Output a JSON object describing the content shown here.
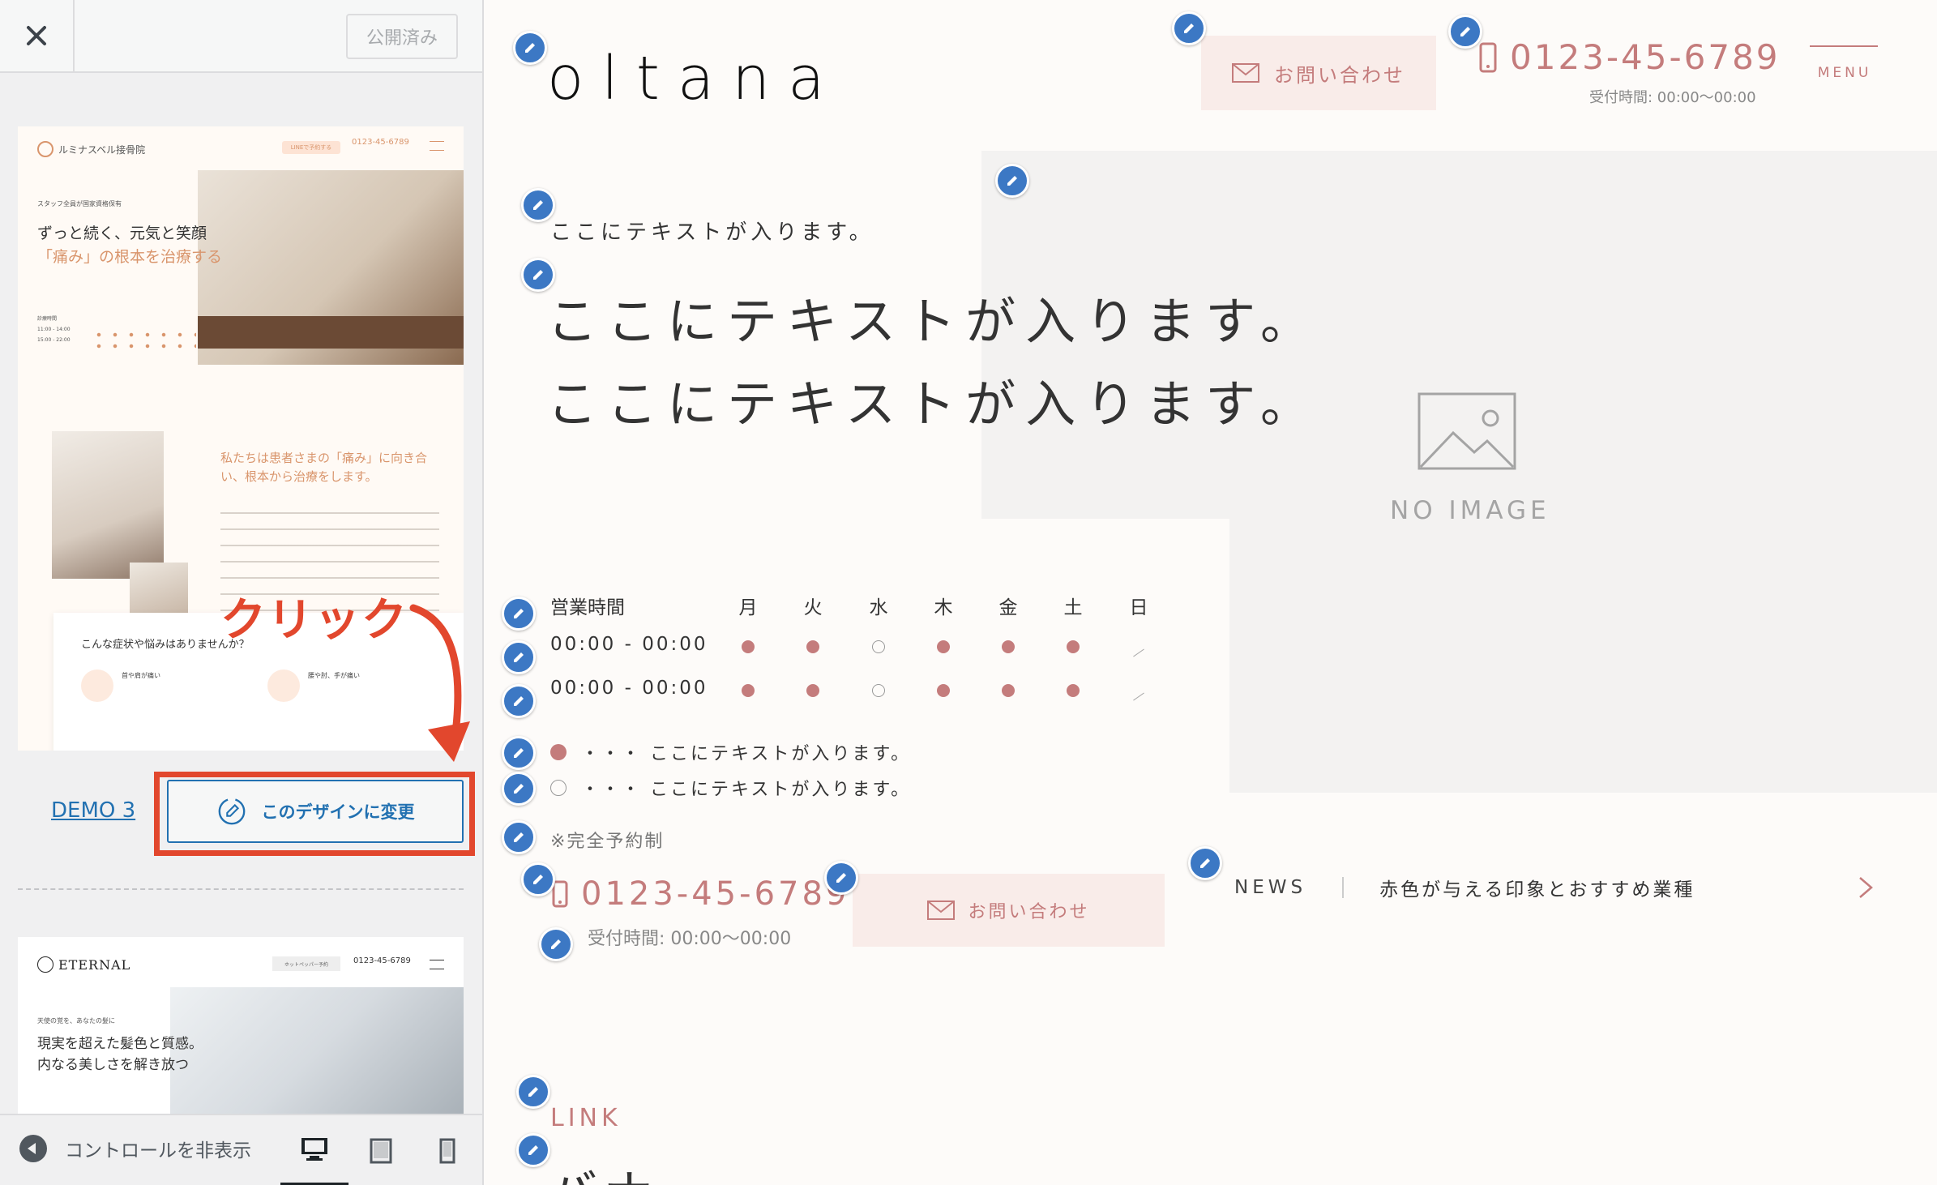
{
  "panel": {
    "publish_label": "公開済み",
    "demo_label": "DEMO 3",
    "change_label": "このデザインに変更",
    "annotation_label": "クリック",
    "hide_controls_label": "コントロールを非表示",
    "thumb1": {
      "logo": "ルミナスベル接骨院",
      "line_btn": "LINEで予約する",
      "phone": "0123-45-6789",
      "sub": "スタッフ全員が国家資格保有",
      "h1_line1": "ずっと続く、元気と笑顔",
      "h1_line2": "「痛み」の根本を治療する",
      "hours_title": "診療時間",
      "hours_row1": "11:00 - 14:00",
      "hours_row2": "15:00 - 22:00",
      "about": "私たちは患者さまの「痛み」に向き合い、根本から治療をします。",
      "card_title": "こんな症状や悩みはありませんか？",
      "card_item1": "首や肩が痛い",
      "card_item2": "腰や肘、手が痛い"
    },
    "thumb2": {
      "logo": "ETERNAL",
      "btn": "ホットペッパー予約",
      "phone": "0123-45-6789",
      "sub": "天使の覚を、あなたの髪に",
      "h1_line1": "現実を超えた髪色と質感。",
      "h1_line2": "内なる美しさを解き放つ"
    }
  },
  "preview": {
    "logo": "oltana",
    "contact_label": "お問い合わせ",
    "phone": "0123-45-6789",
    "phone_hours": "受付時間: 00:00〜00:00",
    "menu_label": "MENU",
    "small_text": "ここにテキストが入ります。",
    "big_line1": "ここにテキストが入ります。",
    "big_line2": "ここにテキストが入ります。",
    "no_image_label": "NO IMAGE",
    "hours": {
      "title": "営業時間",
      "days": [
        "月",
        "火",
        "水",
        "木",
        "金",
        "土",
        "日"
      ],
      "rows": [
        {
          "time": "00:00 - 00:00",
          "marks": [
            "full",
            "full",
            "empty",
            "full",
            "full",
            "full",
            "none"
          ]
        },
        {
          "time": "00:00 - 00:00",
          "marks": [
            "full",
            "full",
            "empty",
            "full",
            "full",
            "full",
            "none"
          ]
        }
      ]
    },
    "legend_full": "・・・ ここにテキストが入ります。",
    "legend_empty": "・・・ ここにテキストが入ります。",
    "reserve_note": "※完全予約制",
    "phone2": "0123-45-6789",
    "phone2_hours": "受付時間: 00:00〜00:00",
    "contact2_label": "お問い合わせ",
    "news_label": "NEWS",
    "news_title": "赤色が与える印象とおすすめ業種",
    "link_heading": "LINK",
    "banner_heading": "バナー"
  },
  "colors": {
    "accent": "#c47c7c",
    "wp_blue": "#2271b1",
    "annotation_red": "#e2472d",
    "edit_pencil": "#3c78c4"
  }
}
